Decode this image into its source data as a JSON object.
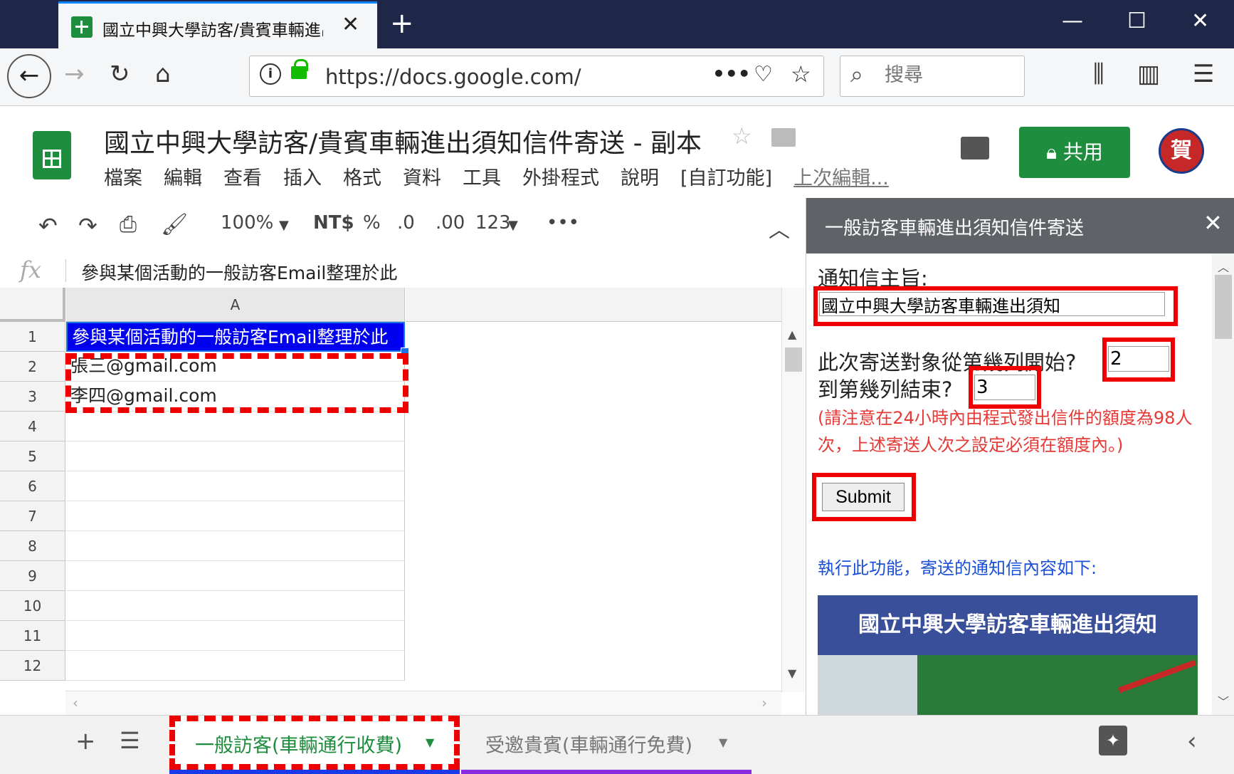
{
  "browser": {
    "tab_title": "國立中興大學訪客/貴賓車輛進出",
    "new_tab": "+",
    "url": "https://docs.google.com/spreadshe",
    "search_placeholder": "搜尋"
  },
  "sheets": {
    "doc_title": "國立中興大學訪客/貴賓車輛進出須知信件寄送 - 副本",
    "menu": [
      "檔案",
      "編輯",
      "查看",
      "插入",
      "格式",
      "資料",
      "工具",
      "外掛程式",
      "說明",
      "[自訂功能]"
    ],
    "last_edit": "上次編輯...",
    "share_label": "共用",
    "avatar_text": "賀"
  },
  "toolbar": {
    "zoom": "100%",
    "currency": "NT$",
    "percent": "%",
    "dec_decrease": ".0",
    "dec_increase": ".00",
    "format_more": "123",
    "more": "•••"
  },
  "formula_bar": {
    "fx": "fx",
    "value": "參與某個活動的一般訪客Email整理於此"
  },
  "grid": {
    "column_header": "A",
    "rows": [
      {
        "num": "1",
        "value": "參與某個活動的一般訪客Email整理於此"
      },
      {
        "num": "2",
        "value": "張三@gmail.com"
      },
      {
        "num": "3",
        "value": "李四@gmail.com"
      },
      {
        "num": "4",
        "value": ""
      },
      {
        "num": "5",
        "value": ""
      },
      {
        "num": "6",
        "value": ""
      },
      {
        "num": "7",
        "value": ""
      },
      {
        "num": "8",
        "value": ""
      },
      {
        "num": "9",
        "value": ""
      },
      {
        "num": "10",
        "value": ""
      },
      {
        "num": "11",
        "value": ""
      },
      {
        "num": "12",
        "value": ""
      }
    ]
  },
  "sidebar": {
    "title": "一般訪客車輛進出須知信件寄送",
    "subject_label": "通知信主旨:",
    "subject_value": "國立中興大學訪客車輛進出須知",
    "start_label": "此次寄送對象從第幾列開始?",
    "start_value": "2",
    "end_label": "到第幾列結束?",
    "end_value": "3",
    "note": "(請注意在24小時內由程式發出信件的額度為98人次，上述寄送人次之設定必須在額度內。)",
    "submit_label": "Submit",
    "preview_label": "執行此功能，寄送的通知信內容如下:",
    "preview_banner": "國立中興大學訪客車輛進出須知"
  },
  "sheet_tabs": [
    {
      "label": "一般訪客(車輛通行收費)",
      "active": true
    },
    {
      "label": "受邀貴賓(車輛通行免費)",
      "active": false
    }
  ],
  "colors": {
    "accent_green": "#1e8e3e",
    "highlight_red": "#ee0000",
    "selected_cell": "#0000ee",
    "note_red": "#e53935",
    "link_blue": "#1a4fd6"
  }
}
